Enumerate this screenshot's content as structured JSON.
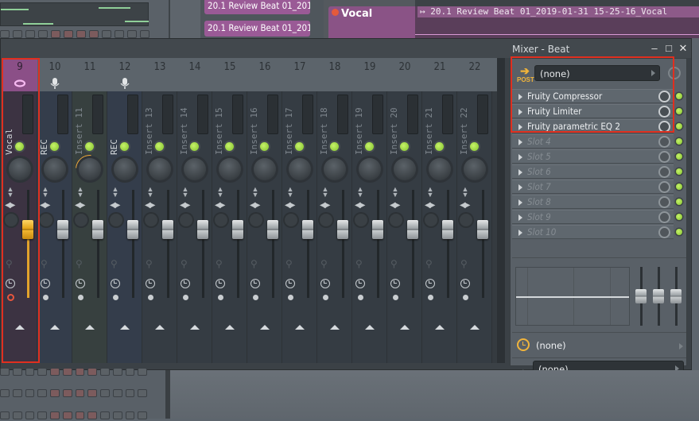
{
  "background": {
    "clips": [
      "20.1 Review Beat 01_201..",
      "20.1 Review Beat 01_201.."
    ],
    "track_name": "Vocal",
    "arrangement_clip_title": "↦ 20.1 Review Beat 01_2019-01-31 15-25-16_Vocal"
  },
  "mixer": {
    "title": "Mixer - Beat",
    "window_buttons": {
      "minimize": "–",
      "maximize": "□",
      "close": "✕"
    },
    "accent_color": "#e2a32b",
    "selection_color": "#e02f1f",
    "selected_insert": 9,
    "inserts": [
      {
        "number": "9",
        "name": "Vocal",
        "icon": "lips-icon",
        "selected": true,
        "fader_level": 0.72,
        "record_armed": true,
        "pan_arc": false
      },
      {
        "number": "10",
        "name": "REC",
        "icon": "microphone-icon",
        "selected": false,
        "fader_level": 0.72,
        "record_armed": false,
        "pan_arc": false
      },
      {
        "number": "11",
        "name": "Insert 11",
        "icon": "",
        "selected": false,
        "fader_level": 0.72,
        "record_armed": false,
        "pan_arc": true
      },
      {
        "number": "12",
        "name": "REC",
        "icon": "microphone-icon",
        "selected": false,
        "fader_level": 0.72,
        "record_armed": false,
        "pan_arc": false
      },
      {
        "number": "13",
        "name": "Insert 13",
        "icon": "",
        "selected": false,
        "fader_level": 0.72,
        "record_armed": false,
        "pan_arc": false
      },
      {
        "number": "14",
        "name": "Insert 14",
        "icon": "",
        "selected": false,
        "fader_level": 0.72,
        "record_armed": false,
        "pan_arc": false
      },
      {
        "number": "15",
        "name": "Insert 15",
        "icon": "",
        "selected": false,
        "fader_level": 0.72,
        "record_armed": false,
        "pan_arc": false
      },
      {
        "number": "16",
        "name": "Insert 16",
        "icon": "",
        "selected": false,
        "fader_level": 0.72,
        "record_armed": false,
        "pan_arc": false
      },
      {
        "number": "17",
        "name": "Insert 17",
        "icon": "",
        "selected": false,
        "fader_level": 0.72,
        "record_armed": false,
        "pan_arc": false
      },
      {
        "number": "18",
        "name": "Insert 18",
        "icon": "",
        "selected": false,
        "fader_level": 0.72,
        "record_armed": false,
        "pan_arc": false
      },
      {
        "number": "19",
        "name": "Insert 19",
        "icon": "",
        "selected": false,
        "fader_level": 0.72,
        "record_armed": false,
        "pan_arc": false
      },
      {
        "number": "20",
        "name": "Insert 20",
        "icon": "",
        "selected": false,
        "fader_level": 0.72,
        "record_armed": false,
        "pan_arc": false
      },
      {
        "number": "21",
        "name": "Insert 21",
        "icon": "",
        "selected": false,
        "fader_level": 0.72,
        "record_armed": false,
        "pan_arc": false
      },
      {
        "number": "22",
        "name": "Insert 22",
        "icon": "",
        "selected": false,
        "fader_level": 0.72,
        "record_armed": false,
        "pan_arc": false
      }
    ],
    "fx_panel": {
      "input_label": "POST",
      "input_value": "(none)",
      "slots": [
        {
          "label": "Fruity Compressor",
          "filled": true
        },
        {
          "label": "Fruity Limiter",
          "filled": true
        },
        {
          "label": "Fruity parametric EQ 2",
          "filled": true
        },
        {
          "label": "Slot 4",
          "filled": false
        },
        {
          "label": "Slot 5",
          "filled": false
        },
        {
          "label": "Slot 6",
          "filled": false
        },
        {
          "label": "Slot 7",
          "filled": false
        },
        {
          "label": "Slot 8",
          "filled": false
        },
        {
          "label": "Slot 9",
          "filled": false
        },
        {
          "label": "Slot 10",
          "filled": false
        }
      ],
      "latency_value": "(none)",
      "output_value": "(none)"
    }
  }
}
